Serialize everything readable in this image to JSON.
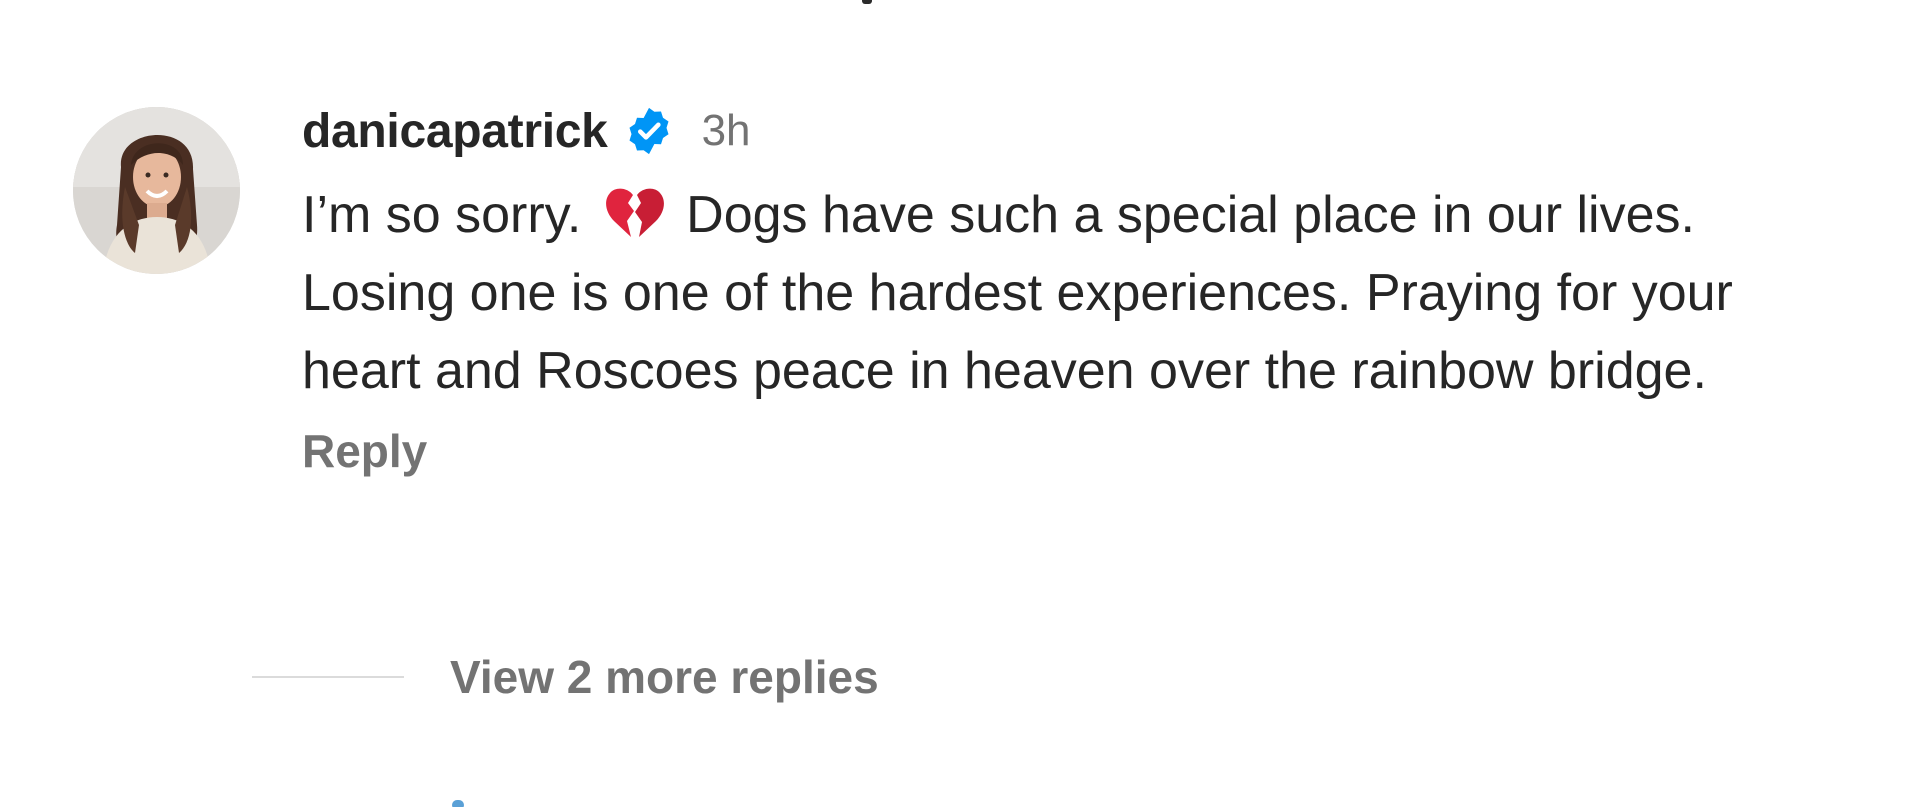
{
  "comment": {
    "username": "danicapatrick",
    "verified": true,
    "timestamp": "3h",
    "text_before_emoji": "I’m so sorry.",
    "emoji": "broken-heart-icon",
    "text_after_emoji": "Dogs have such a special place in our lives. Losing one is one of the hardest experiences. Praying for your heart and Roscoes peace in heaven over the rainbow bridge.",
    "reply_label": "Reply",
    "view_replies_label": "View 2 more replies"
  },
  "colors": {
    "username": "#262626",
    "secondary_text": "#737373",
    "verified_badge": "#0095F6",
    "broken_heart": "#E0243E",
    "divider": "#DBDBDB"
  }
}
